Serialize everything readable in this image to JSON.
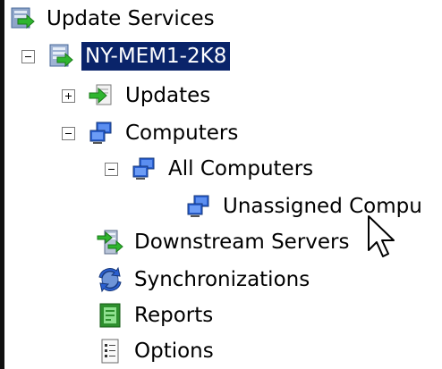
{
  "tree": {
    "root": {
      "label": "Update Services",
      "icon": "update-services-icon"
    },
    "server": {
      "label": "NY-MEM1-2K8",
      "icon": "server-icon",
      "expander": "minus"
    },
    "updates": {
      "label": "Updates",
      "icon": "updates-icon",
      "expander": "plus"
    },
    "computers": {
      "label": "Computers",
      "icon": "computers-icon",
      "expander": "minus"
    },
    "all_computers": {
      "label": "All Computers",
      "icon": "computer-group-icon",
      "expander": "minus"
    },
    "unassigned": {
      "label": "Unassigned Compu",
      "icon": "computer-group-icon"
    },
    "downstream": {
      "label": "Downstream Servers",
      "icon": "downstream-servers-icon"
    },
    "synchronizations": {
      "label": "Synchronizations",
      "icon": "synchronizations-icon"
    },
    "reports": {
      "label": "Reports",
      "icon": "reports-icon"
    },
    "options": {
      "label": "Options",
      "icon": "options-icon"
    }
  },
  "colors": {
    "selection_background": "#0a246a",
    "selection_text": "#ffffff"
  }
}
